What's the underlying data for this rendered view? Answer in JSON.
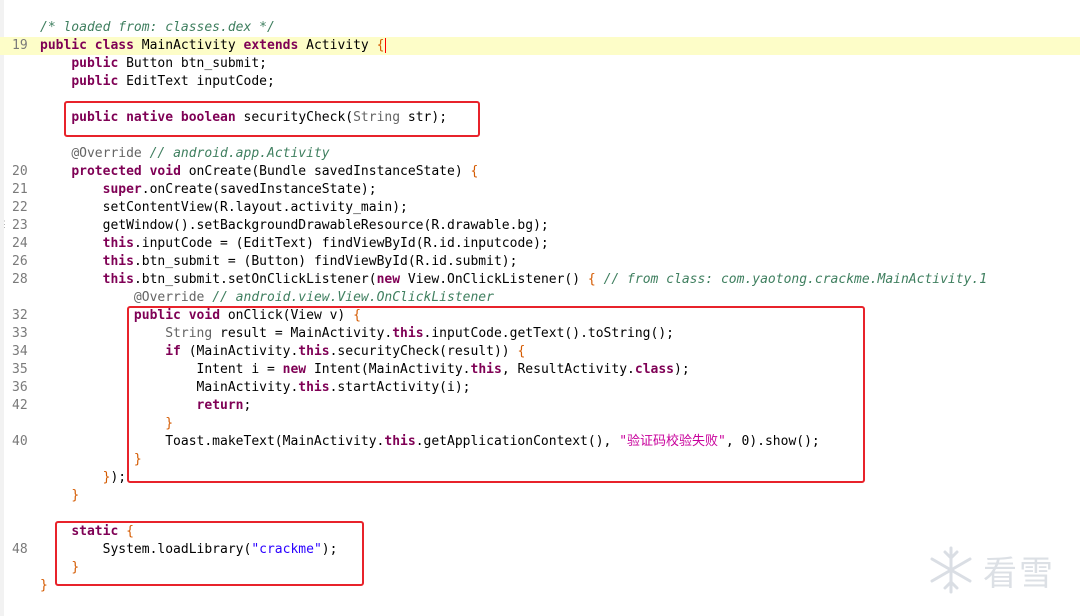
{
  "editor": {
    "lines": [
      {
        "num": "",
        "parts": [
          [
            "cm",
            "/* loaded from: classes.dex */"
          ]
        ]
      },
      {
        "num": "19",
        "highlight": true,
        "caret": true,
        "parts": [
          [
            "kw",
            "public"
          ],
          [
            "t",
            " "
          ],
          [
            "kw",
            "class"
          ],
          [
            "t",
            " MainActivity "
          ],
          [
            "kw",
            "extends"
          ],
          [
            "t",
            " Activity "
          ],
          [
            "br",
            "{"
          ]
        ]
      },
      {
        "num": "",
        "parts": [
          [
            "t",
            "    "
          ],
          [
            "kw",
            "public"
          ],
          [
            "t",
            " Button btn_submit;"
          ]
        ]
      },
      {
        "num": "",
        "parts": [
          [
            "t",
            "    "
          ],
          [
            "kw",
            "public"
          ],
          [
            "t",
            " EditText inputCode;"
          ]
        ]
      },
      {
        "num": "",
        "parts": []
      },
      {
        "num": "",
        "parts": [
          [
            "t",
            "    "
          ],
          [
            "kw",
            "public"
          ],
          [
            "t",
            " "
          ],
          [
            "kw",
            "native"
          ],
          [
            "t",
            " "
          ],
          [
            "kw",
            "boolean"
          ],
          [
            "t",
            " securityCheck("
          ],
          [
            "an",
            "String"
          ],
          [
            "t",
            " str);"
          ]
        ]
      },
      {
        "num": "",
        "parts": []
      },
      {
        "num": "",
        "parts": [
          [
            "t",
            "    "
          ],
          [
            "an",
            "@Override"
          ],
          [
            "t",
            " "
          ],
          [
            "cm",
            "// android.app.Activity"
          ]
        ]
      },
      {
        "num": "20",
        "parts": [
          [
            "t",
            "    "
          ],
          [
            "kw",
            "protected"
          ],
          [
            "t",
            " "
          ],
          [
            "kw",
            "void"
          ],
          [
            "t",
            " onCreate(Bundle savedInstanceState) "
          ],
          [
            "br",
            "{"
          ]
        ]
      },
      {
        "num": "21",
        "parts": [
          [
            "t",
            "        "
          ],
          [
            "kw",
            "super"
          ],
          [
            "t",
            ".onCreate(savedInstanceState);"
          ]
        ]
      },
      {
        "num": "22",
        "parts": [
          [
            "t",
            "        setContentView(R.layout.activity_main);"
          ]
        ]
      },
      {
        "num": "23",
        "parts": [
          [
            "t",
            "        getWindow().setBackgroundDrawableResource(R.drawable.bg);"
          ]
        ]
      },
      {
        "num": "24",
        "parts": [
          [
            "t",
            "        "
          ],
          [
            "kw",
            "this"
          ],
          [
            "t",
            ".inputCode = (EditText) findViewById(R.id.inputcode);"
          ]
        ]
      },
      {
        "num": "26",
        "parts": [
          [
            "t",
            "        "
          ],
          [
            "kw",
            "this"
          ],
          [
            "t",
            ".btn_submit = (Button) findViewById(R.id.submit);"
          ]
        ]
      },
      {
        "num": "28",
        "parts": [
          [
            "t",
            "        "
          ],
          [
            "kw",
            "this"
          ],
          [
            "t",
            ".btn_submit.setOnClickListener("
          ],
          [
            "kw",
            "new"
          ],
          [
            "t",
            " View.OnClickListener() "
          ],
          [
            "br",
            "{"
          ],
          [
            "t",
            " "
          ],
          [
            "cm",
            "// from class: com.yaotong.crackme.MainActivity.1"
          ]
        ]
      },
      {
        "num": "",
        "parts": [
          [
            "t",
            "            "
          ],
          [
            "an",
            "@Override"
          ],
          [
            "t",
            " "
          ],
          [
            "cm",
            "// android.view.View.OnClickListener"
          ]
        ]
      },
      {
        "num": "32",
        "parts": [
          [
            "t",
            "            "
          ],
          [
            "kw",
            "public"
          ],
          [
            "t",
            " "
          ],
          [
            "kw",
            "void"
          ],
          [
            "t",
            " onClick(View v) "
          ],
          [
            "br",
            "{"
          ]
        ]
      },
      {
        "num": "33",
        "parts": [
          [
            "t",
            "                "
          ],
          [
            "an",
            "String"
          ],
          [
            "t",
            " result = MainActivity."
          ],
          [
            "kw",
            "this"
          ],
          [
            "t",
            ".inputCode.getText().toString();"
          ]
        ]
      },
      {
        "num": "34",
        "parts": [
          [
            "t",
            "                "
          ],
          [
            "kw",
            "if"
          ],
          [
            "t",
            " (MainActivity."
          ],
          [
            "kw",
            "this"
          ],
          [
            "t",
            ".securityCheck(result)) "
          ],
          [
            "br",
            "{"
          ]
        ]
      },
      {
        "num": "35",
        "parts": [
          [
            "t",
            "                    Intent i = "
          ],
          [
            "kw",
            "new"
          ],
          [
            "t",
            " Intent(MainActivity."
          ],
          [
            "kw",
            "this"
          ],
          [
            "t",
            ", ResultActivity."
          ],
          [
            "kw",
            "class"
          ],
          [
            "t",
            ");"
          ]
        ]
      },
      {
        "num": "36",
        "parts": [
          [
            "t",
            "                    MainActivity."
          ],
          [
            "kw",
            "this"
          ],
          [
            "t",
            ".startActivity(i);"
          ]
        ]
      },
      {
        "num": "42",
        "parts": [
          [
            "t",
            "                    "
          ],
          [
            "kw",
            "return"
          ],
          [
            "t",
            ";"
          ]
        ]
      },
      {
        "num": "",
        "parts": [
          [
            "t",
            "                "
          ],
          [
            "br",
            "}"
          ]
        ]
      },
      {
        "num": "40",
        "parts": [
          [
            "t",
            "                Toast.makeText(MainActivity."
          ],
          [
            "kw",
            "this"
          ],
          [
            "t",
            ".getApplicationContext(), "
          ],
          [
            "strc",
            "\"验证码校验失败\""
          ],
          [
            "t",
            ", 0).show();"
          ]
        ]
      },
      {
        "num": "",
        "parts": [
          [
            "t",
            "            "
          ],
          [
            "br",
            "}"
          ]
        ]
      },
      {
        "num": "",
        "parts": [
          [
            "t",
            "        "
          ],
          [
            "br",
            "}"
          ],
          [
            "t",
            ");"
          ]
        ]
      },
      {
        "num": "",
        "parts": [
          [
            "t",
            "    "
          ],
          [
            "br",
            "}"
          ]
        ]
      },
      {
        "num": "",
        "parts": []
      },
      {
        "num": "",
        "parts": [
          [
            "t",
            "    "
          ],
          [
            "kw",
            "static"
          ],
          [
            "t",
            " "
          ],
          [
            "br",
            "{"
          ]
        ]
      },
      {
        "num": "48",
        "parts": [
          [
            "t",
            "        System.loadLibrary("
          ],
          [
            "str",
            "\"crackme\""
          ],
          [
            "t",
            ");"
          ]
        ]
      },
      {
        "num": "",
        "parts": [
          [
            "t",
            "    "
          ],
          [
            "br",
            "}"
          ]
        ]
      },
      {
        "num": "",
        "parts": [
          [
            "br",
            "}"
          ]
        ]
      }
    ]
  },
  "watermark": {
    "text": "看雪",
    "icon": "snowflake-icon"
  }
}
